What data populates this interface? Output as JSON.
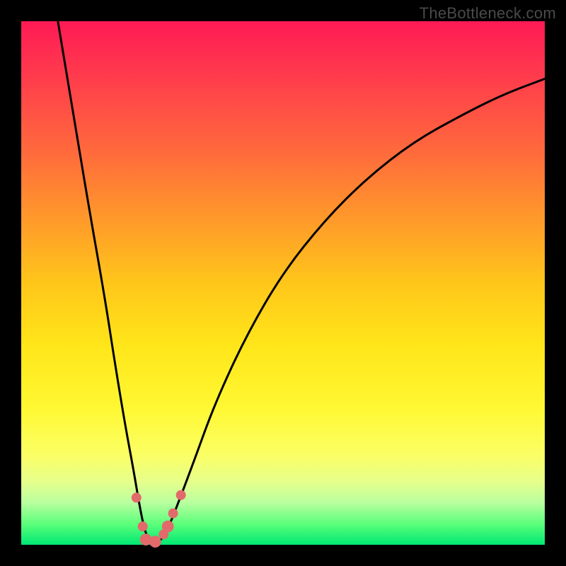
{
  "watermark": "TheBottleneck.com",
  "chart_data": {
    "type": "line",
    "title": "",
    "xlabel": "",
    "ylabel": "",
    "xlim": [
      0,
      100
    ],
    "ylim": [
      0,
      100
    ],
    "series": [
      {
        "name": "bottleneck-curve",
        "x": [
          7,
          10,
          13,
          16,
          18,
          20,
          21.5,
          22.5,
          23.5,
          24.5,
          26.5,
          28,
          30,
          33,
          37,
          43,
          50,
          58,
          66,
          75,
          84,
          92,
          100
        ],
        "values": [
          100,
          82,
          64,
          47,
          34,
          22,
          14,
          8,
          3,
          0.5,
          0.5,
          3,
          8,
          16,
          27,
          40,
          52,
          62,
          70,
          77,
          82,
          86,
          89
        ]
      }
    ],
    "markers": [
      {
        "x": 22.0,
        "y": 9.0,
        "r": 1.0
      },
      {
        "x": 23.2,
        "y": 3.5,
        "r": 1.0
      },
      {
        "x": 23.8,
        "y": 1.0,
        "r": 1.2
      },
      {
        "x": 25.6,
        "y": 0.6,
        "r": 1.2
      },
      {
        "x": 27.2,
        "y": 2.0,
        "r": 1.0
      },
      {
        "x": 28.0,
        "y": 3.5,
        "r": 1.2
      },
      {
        "x": 29.0,
        "y": 6.0,
        "r": 1.0
      },
      {
        "x": 30.5,
        "y": 9.5,
        "r": 1.0
      }
    ],
    "marker_color": "#e26a6a",
    "curve_color": "#000000",
    "gradient_stops": [
      {
        "pct": 0,
        "color": "#ff1a55"
      },
      {
        "pct": 50,
        "color": "#ffc61a"
      },
      {
        "pct": 80,
        "color": "#fff94d"
      },
      {
        "pct": 100,
        "color": "#00e873"
      }
    ]
  }
}
